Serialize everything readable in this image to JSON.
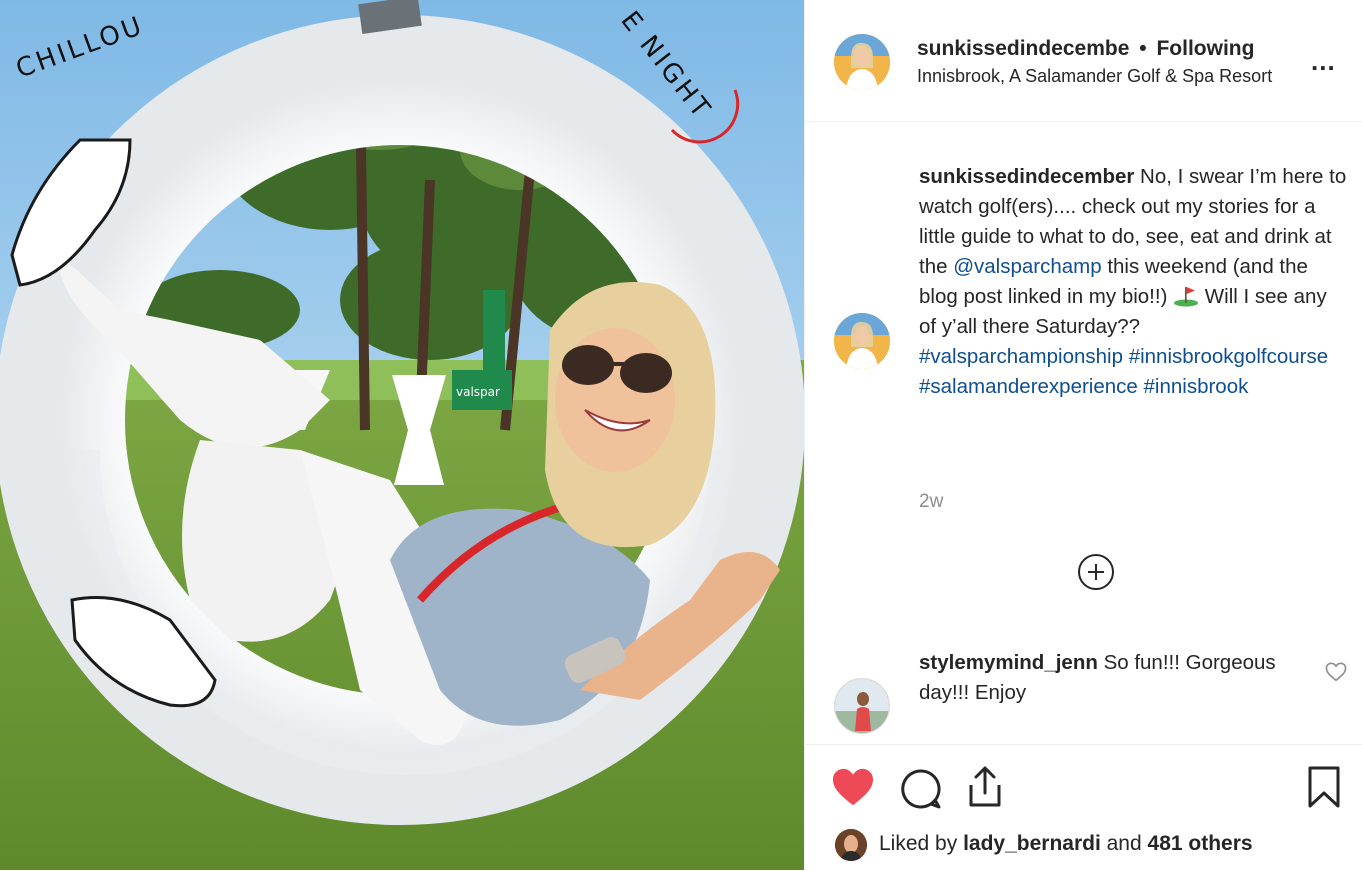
{
  "post": {
    "photo": {
      "ring_text_left": "CHILLOU",
      "ring_text_right": "E NIGHT",
      "sign_text": "valspar"
    },
    "header": {
      "username": "sunkissedindecembe",
      "separator": "•",
      "follow_status": "Following",
      "location": "Innisbrook, A Salamander Golf & Spa Resort",
      "more_label": "..."
    },
    "caption": {
      "username": "sunkissedindecember",
      "text_1": " No, I swear I’m here to watch golf(ers).... check out my stories for a little guide to what to do, see, eat and drink at the ",
      "mention": "@valsparchamp",
      "text_2": " this weekend (and the blog post linked in my bio!!) ",
      "emoji": "golf-flag",
      "text_3": " Will I see any of y’all there Saturday?? ",
      "hashtags": [
        "#valsparchampionship",
        "#innisbrookgolfcourse",
        "#salamanderexperience",
        "#innisbrook"
      ],
      "timestamp": "2w"
    },
    "comments": [
      {
        "username": "stylemymind_jenn",
        "text": " So fun!!! Gorgeous day!!! Enjoy"
      }
    ],
    "actions": {
      "liked": true,
      "icons": [
        "heart-icon",
        "comment-icon",
        "share-icon",
        "bookmark-icon"
      ]
    },
    "likes": {
      "prefix": "Liked by ",
      "user": "lady_bernardi",
      "middle": " and ",
      "count": "481 others"
    },
    "colors": {
      "link": "#0f4f8f",
      "heart": "#ed4956",
      "muted": "#8e8e8e"
    }
  }
}
